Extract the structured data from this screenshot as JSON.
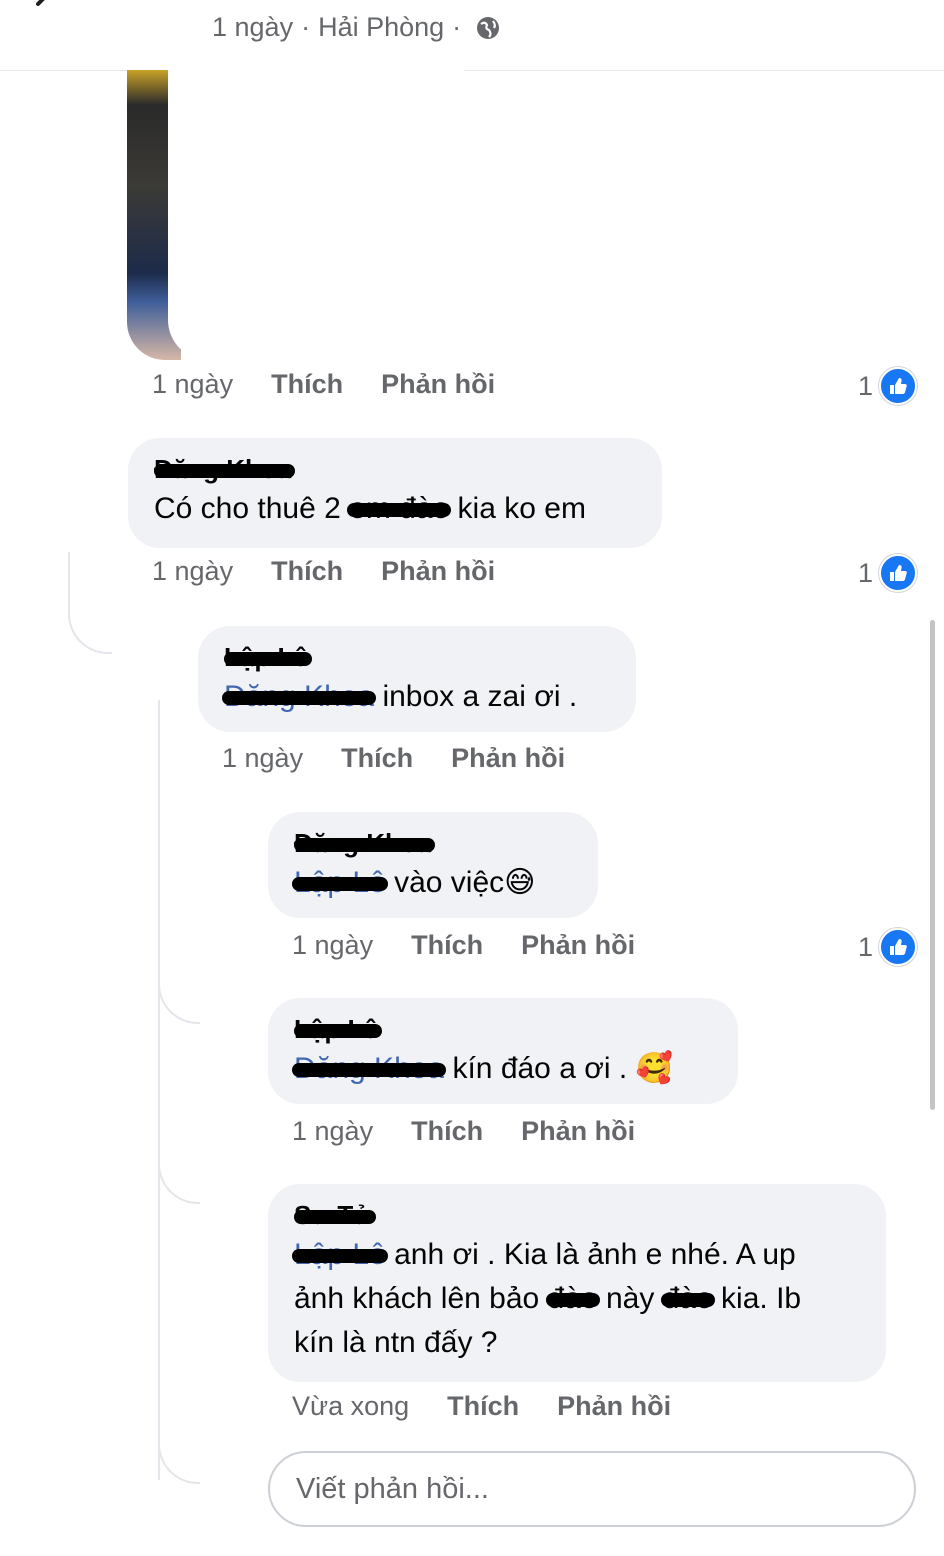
{
  "header": {
    "time": "1 ngày",
    "separator": "·",
    "location": "Hải Phòng",
    "separator2": "·"
  },
  "icons": {
    "back": "back-arrow-icon",
    "globe": "globe-icon",
    "more": "more-options-icon",
    "like": "like-thumb-icon"
  },
  "colors": {
    "like_blue": "#1877f2",
    "mention_blue": "#4267b2",
    "bubble_bg": "#f0f2f5",
    "meta_gray": "#65676b"
  },
  "post_actions": {
    "time": "1 ngày",
    "like": "Thích",
    "reply": "Phản hồi",
    "like_count": "1"
  },
  "comments": [
    {
      "author": "Đăng Khoa",
      "text_a": "Có cho thuê 2 ",
      "text_scratched": "em đào",
      "text_b": " kia ko em",
      "time": "1 ngày",
      "like": "Thích",
      "reply": "Phản hồi",
      "like_count": "1"
    },
    {
      "author": "Lập Lê",
      "mention": "Đăng Khoa",
      "text": " inbox a zai ơi .",
      "time": "1 ngày",
      "like": "Thích",
      "reply": "Phản hồi"
    },
    {
      "author": "Đăng Khoa",
      "mention": "Lập Lê",
      "text": " vào việc",
      "emoji": "😅",
      "time": "1 ngày",
      "like": "Thích",
      "reply": "Phản hồi",
      "like_count": "1"
    },
    {
      "author": "Lập Lê",
      "mention": "Đăng Khoa",
      "text": " kín đáo a ơi . ",
      "emoji": "🥰",
      "time": "1 ngày",
      "like": "Thích",
      "reply": "Phản hồi"
    },
    {
      "author": "Sư Tử",
      "mention": "Lập Lê",
      "line1": " anh ơi . Kia là ảnh e nhé. A up",
      "line2_a": "ảnh khách lên bảo ",
      "line2_s1": "đào",
      "line2_b": " này ",
      "line2_s2": "đào",
      "line2_c": " kia. Ib",
      "line3": "kín là ntn đấy ?",
      "time": "Vừa xong",
      "like": "Thích",
      "reply": "Phản hồi"
    }
  ],
  "reply_box": {
    "placeholder": "Viết phản hồi..."
  }
}
